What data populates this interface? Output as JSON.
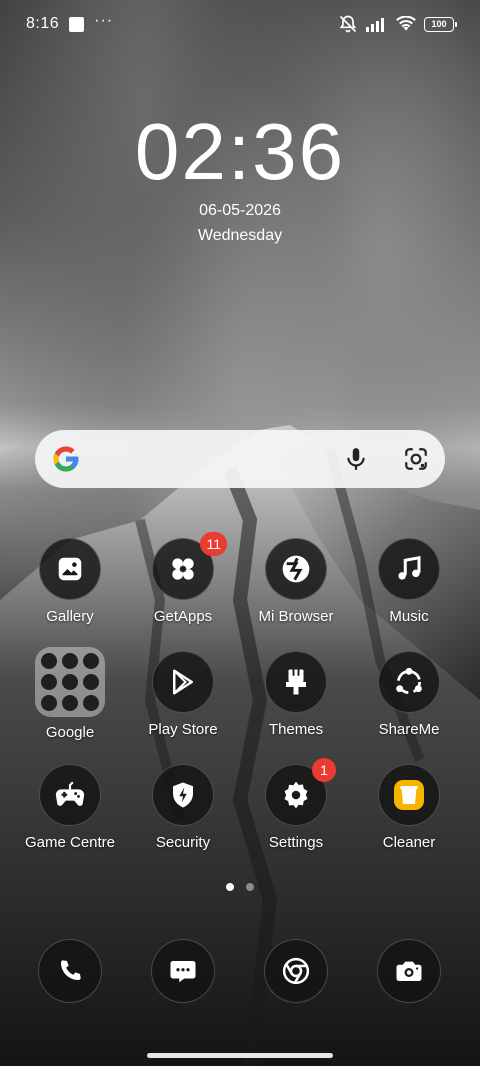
{
  "status_bar": {
    "time": "8:16",
    "dots": "···",
    "battery": "100",
    "icons": [
      "notification-square-icon",
      "bell-muted-icon",
      "signal-icon",
      "wifi-icon",
      "battery-icon"
    ]
  },
  "clock": {
    "time": "02:36",
    "date": "06-05-2026",
    "weekday": "Wednesday"
  },
  "search": {
    "icons": [
      "google-logo-icon",
      "microphone-icon",
      "google-lens-icon"
    ]
  },
  "apps": [
    {
      "label": "Gallery",
      "icon": "gallery-icon"
    },
    {
      "label": "GetApps",
      "icon": "getapps-icon",
      "badge": "11"
    },
    {
      "label": "Mi Browser",
      "icon": "mi-browser-icon"
    },
    {
      "label": "Music",
      "icon": "music-note-icon"
    },
    {
      "label": "Google",
      "icon": "google-folder-icon"
    },
    {
      "label": "Play Store",
      "icon": "play-store-icon"
    },
    {
      "label": "Themes",
      "icon": "themes-brush-icon"
    },
    {
      "label": "ShareMe",
      "icon": "shareme-icon"
    },
    {
      "label": "Game Centre",
      "icon": "gamepad-icon"
    },
    {
      "label": "Security",
      "icon": "security-shield-icon"
    },
    {
      "label": "Settings",
      "icon": "settings-gear-icon",
      "badge": "1"
    },
    {
      "label": "Cleaner",
      "icon": "cleaner-bin-icon"
    }
  ],
  "dock": [
    {
      "icon": "phone-icon"
    },
    {
      "icon": "messages-icon"
    },
    {
      "icon": "chrome-icon"
    },
    {
      "icon": "camera-icon"
    }
  ],
  "page_indicator": {
    "pages": 2,
    "current": 1
  },
  "colors": {
    "badge": "#e93b30",
    "cleaner_accent": "#f7b500"
  }
}
